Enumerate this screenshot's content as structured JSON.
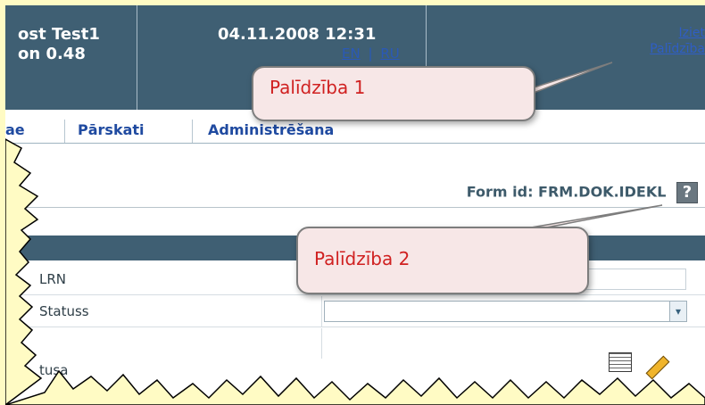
{
  "header": {
    "user_line": "ost Test1",
    "version_line": "on 0.48",
    "datetime": "04.11.2008 12:31",
    "lang_en": "EN",
    "lang_sep": "|",
    "lang_ru": "RU",
    "logout": "Iziet",
    "help": "Palīdzība"
  },
  "menu": {
    "item1": "ae",
    "item2": "Pārskati",
    "item3": "Administrēšana"
  },
  "form": {
    "id_text": "Form id: FRM.DOK.IDEKL",
    "help_icon": "?"
  },
  "fields": [
    {
      "label": "LRN"
    },
    {
      "label": "Statuss"
    },
    {
      "label": "tusa"
    }
  ],
  "callouts": {
    "c1": "Palīdzība 1",
    "c2": "Palīdzība 2"
  },
  "icons": {
    "help": "question-mark-icon",
    "dropdown": "chevron-down-icon",
    "calendar": "calendar-icon",
    "pencil": "pencil-icon"
  }
}
